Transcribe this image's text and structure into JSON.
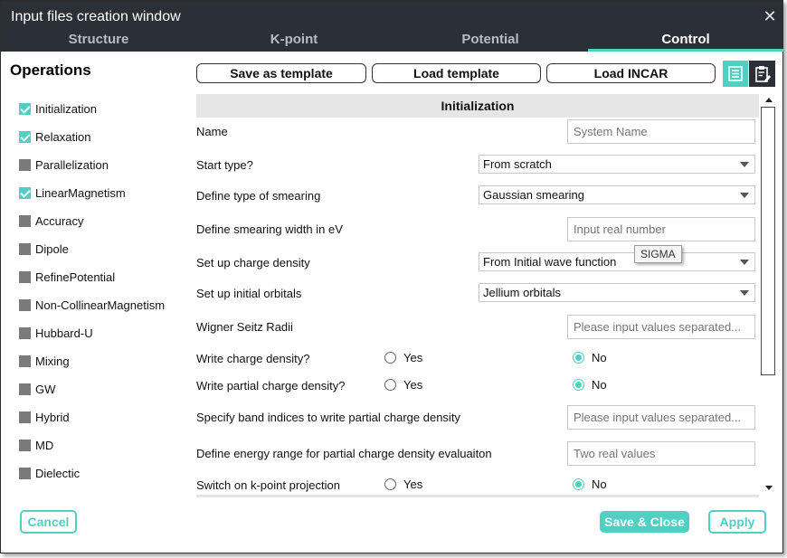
{
  "window": {
    "title": "Input files creation window"
  },
  "tabs": [
    {
      "label": "Structure"
    },
    {
      "label": "K-point"
    },
    {
      "label": "Potential"
    },
    {
      "label": "Control"
    }
  ],
  "active_tab": "Control",
  "operations": {
    "title": "Operations",
    "items": [
      {
        "label": "Initialization",
        "checked": true
      },
      {
        "label": "Relaxation",
        "checked": true
      },
      {
        "label": "Parallelization",
        "checked": false
      },
      {
        "label": "LinearMagnetism",
        "checked": true
      },
      {
        "label": "Accuracy",
        "checked": false
      },
      {
        "label": "Dipole",
        "checked": false
      },
      {
        "label": "RefinePotential",
        "checked": false
      },
      {
        "label": "Non-CollinearMagnetism",
        "checked": false
      },
      {
        "label": "Hubbard-U",
        "checked": false
      },
      {
        "label": "Mixing",
        "checked": false
      },
      {
        "label": "GW",
        "checked": false
      },
      {
        "label": "Hybrid",
        "checked": false
      },
      {
        "label": "MD",
        "checked": false
      },
      {
        "label": "Dielectic",
        "checked": false
      }
    ]
  },
  "toolbar": {
    "save_template": "Save as template",
    "load_template": "Load template",
    "load_incar": "Load INCAR",
    "view_list_icon": "list-view-icon",
    "view_clipboard_icon": "clipboard-edit-icon"
  },
  "form": {
    "section_title": "Initialization",
    "name_label": "Name",
    "name_placeholder": "System Name",
    "start_type_label": "Start type?",
    "start_type_value": "From scratch",
    "smearing_label": "Define type of smearing",
    "smearing_value": "Gaussian smearing",
    "smear_width_label": "Define smearing width in eV",
    "smear_width_placeholder": "Input real number",
    "smear_width_tooltip": "SIGMA",
    "charge_density_label": "Set up charge density",
    "charge_density_value": "From Initial wave function",
    "orbitals_label": "Set up initial orbitals",
    "orbitals_value": "Jellium orbitals",
    "wigner_label": "Wigner Seitz Radii",
    "wigner_placeholder": "Please input values separated...",
    "write_charge_label": "Write charge density?",
    "write_partial_label": "Write partial charge density?",
    "band_indices_label": "Specify band indices to write partial charge density",
    "band_indices_placeholder": "Please input values separated...",
    "energy_range_label": "Define energy range for partial charge density evaluaiton",
    "energy_range_placeholder": "Two real values",
    "kpoint_proj_label": "Switch on k-point projection",
    "yes": "Yes",
    "no": "No",
    "write_charge_selected": "No",
    "write_partial_selected": "No",
    "kpoint_proj_selected": "No"
  },
  "footer": {
    "cancel": "Cancel",
    "save_close": "Save & Close",
    "apply": "Apply"
  },
  "colors": {
    "accent": "#4fd0c2",
    "titlebar": "#2b2f36",
    "unchecked": "#7a7a7a"
  }
}
